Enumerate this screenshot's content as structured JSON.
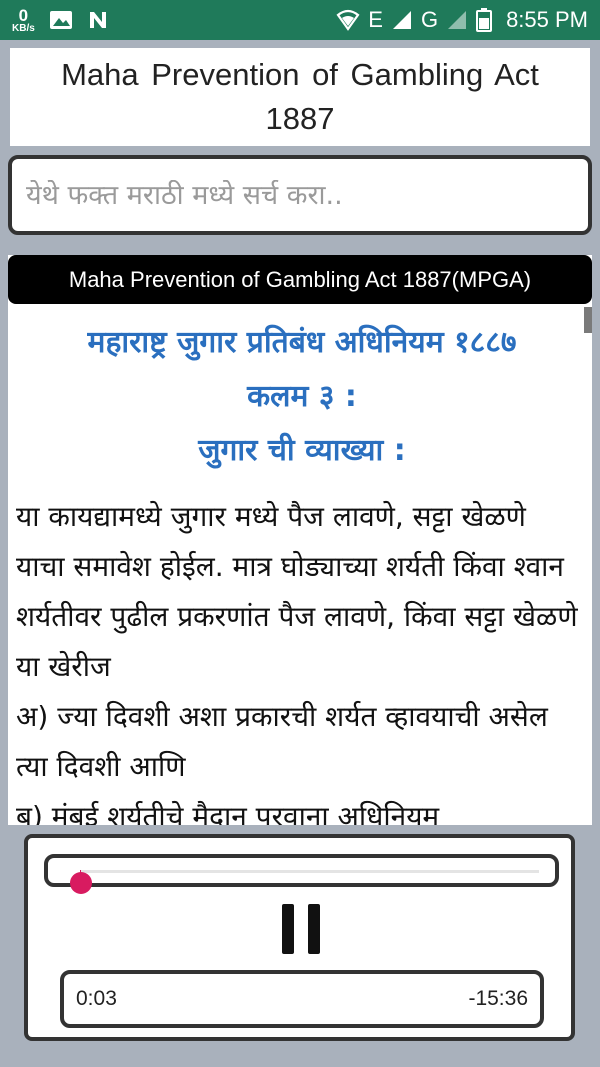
{
  "status_bar": {
    "speed_value": "0",
    "speed_unit": "KB/s",
    "network_e": "E",
    "network_g": "G",
    "time": "8:55 PM",
    "icons": [
      "image-icon",
      "n-app-icon",
      "wifi-icon",
      "signal-icon",
      "battery-icon"
    ]
  },
  "header": {
    "title": "Maha Prevention of Gambling Act 1887"
  },
  "search": {
    "placeholder": "येथे फक्त मराठी मध्ये सर्च करा.."
  },
  "content": {
    "card_title": "Maha Prevention of Gambling Act 1887(MPGA)",
    "heading_line1": "महाराष्ट्र जुगार प्रतिबंध अधिनियम १८८७",
    "heading_line2": "कलम ३ :",
    "heading_line3": "जुगार ची व्याख्या :",
    "paragraph1": "या कायद्यामध्ये जुगार मध्ये पैज लावणे, सट्टा खेळणे याचा समावेश होईल. मात्र घोड्याच्या शर्यती किंवा श्वान शर्यतीवर पुढील प्रकरणांत पैज लावणे, किंवा सट्टा खेळणे या खेरीज",
    "paragraph2": "अ) ज्या दिवशी अशा प्रकारची शर्यत व्हावयाची असेल त्या दिवशी आणि",
    "paragraph3": "ब) मुंबई शर्यतीचे मैदान परवाना अधिनियम"
  },
  "player": {
    "progress": 0.003,
    "elapsed": "0:03",
    "remaining": "-15:36",
    "accent_color": "#d81b60"
  }
}
